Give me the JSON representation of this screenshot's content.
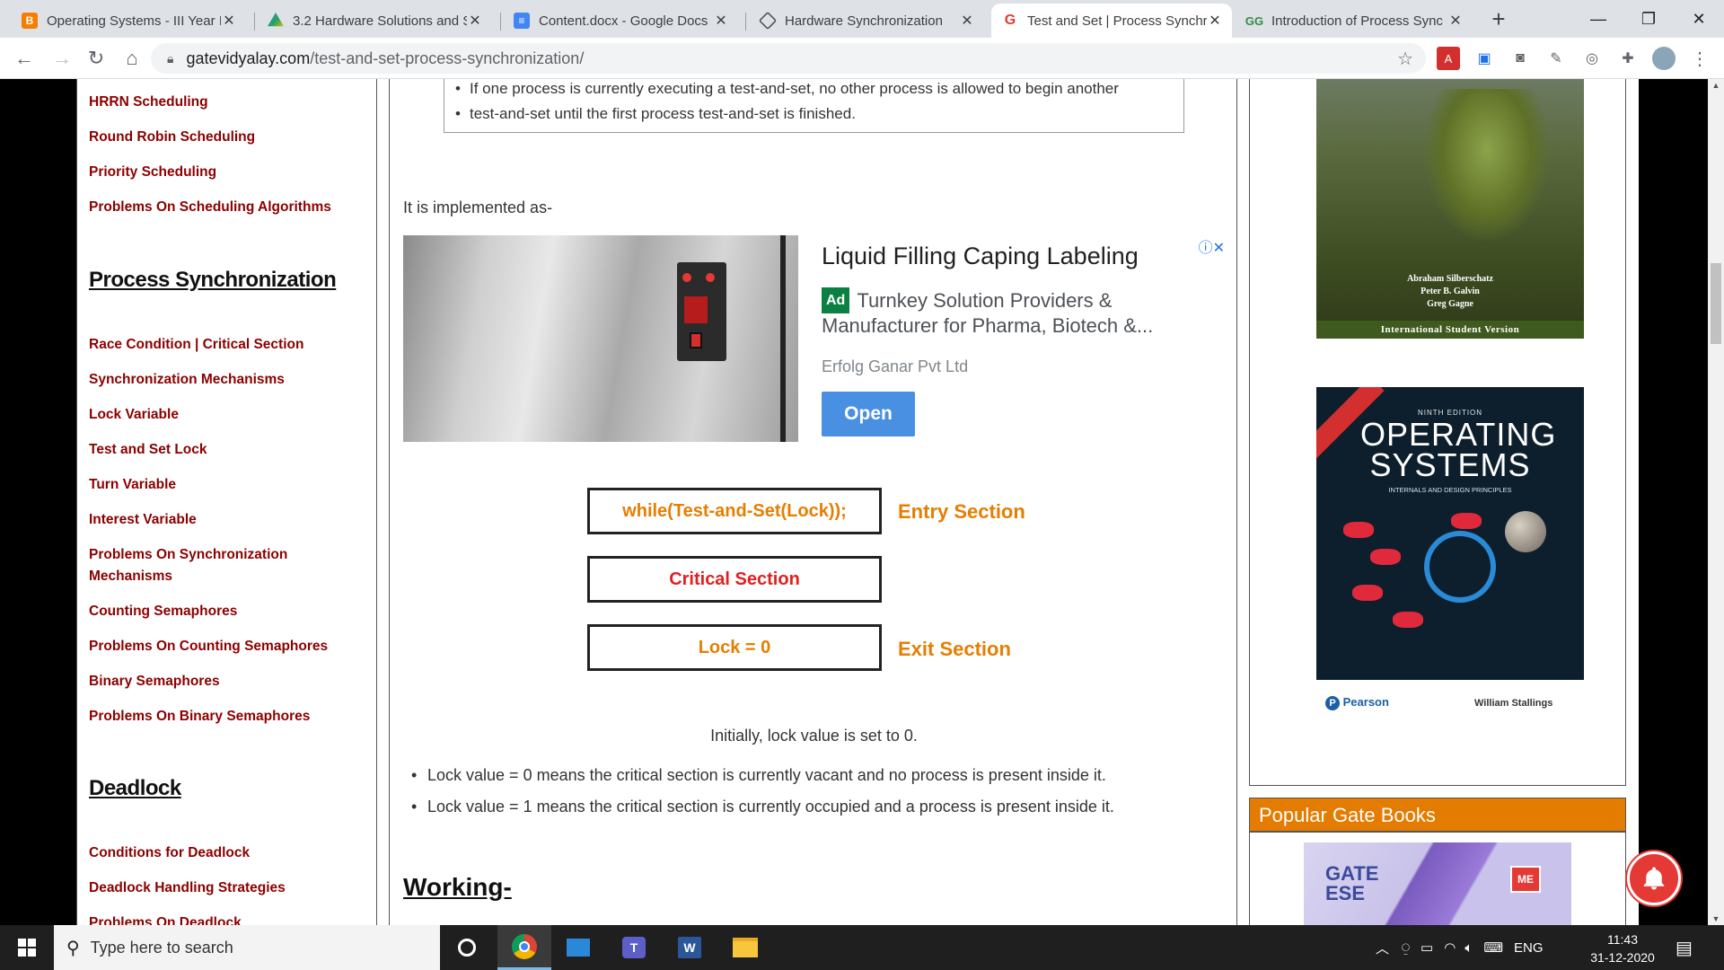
{
  "browser": {
    "tabs": [
      {
        "title": "Operating Systems - III Year I",
        "icon": "blogger-icon",
        "color": "#f57d00"
      },
      {
        "title": "3.2 Hardware Solutions and S",
        "icon": "google-drive-icon",
        "color": "#1fa463"
      },
      {
        "title": "Content.docx - Google Docs",
        "icon": "google-docs-icon",
        "color": "#4285f4"
      },
      {
        "title": "Hardware Synchronization",
        "icon": "diamond-site-icon",
        "color": "#555555"
      },
      {
        "title": "Test and Set | Process Synchr",
        "icon": "gate-vidyalay-icon",
        "color": "#e53935"
      },
      {
        "title": "Introduction of Process Sync",
        "icon": "geeksforgeeks-icon",
        "color": "#2f8d46"
      }
    ],
    "url_host": "gatevidyalay.com",
    "url_path": "/test-and-set-process-synchronization/"
  },
  "sidebar": {
    "links_top": [
      "HRRN Scheduling",
      "Round Robin Scheduling",
      "Priority Scheduling",
      "Problems On Scheduling Algorithms"
    ],
    "heading_sync": "Process Synchronization",
    "links_sync": [
      "Race Condition | Critical Section",
      "Synchronization Mechanisms",
      "Lock Variable",
      "Test and Set Lock",
      "Turn Variable",
      "Interest Variable",
      "Problems On Synchronization",
      "Mechanisms",
      "Counting Semaphores",
      "Problems On Counting Semaphores",
      "Binary Semaphores",
      "Problems On Binary Semaphores"
    ],
    "heading_deadlock": "Deadlock",
    "links_deadlock": [
      "Conditions for Deadlock",
      "Deadlock Handling Strategies",
      "Problems On Deadlock"
    ]
  },
  "main": {
    "note_line1": "If one process is currently executing a test-and-set, no other process is allowed to begin another",
    "note_line2": "test-and-set until the first process test-and-set is finished.",
    "implemented": "It is implemented as-",
    "ad": {
      "title": "Liquid Filling Caping Labeling",
      "badge": "Ad",
      "desc": "Turnkey Solution Providers & Manufacturer for Pharma, Biotech &...",
      "company": "Erfolg Ganar Pvt Ltd",
      "open": "Open",
      "info": "ⓘ✕"
    },
    "code": {
      "entry_code": "while(Test-and-Set(Lock));",
      "entry_label": "Entry Section",
      "critical": "Critical Section",
      "exit_code": "Lock = 0",
      "exit_label": "Exit Section"
    },
    "initially": "Initially, lock value is set to 0.",
    "bullet1": "Lock value = 0 means the critical section is currently vacant and no process is present inside it.",
    "bullet2": "Lock value = 1 means the critical section is currently occupied and a process is present inside it.",
    "working": "Working-"
  },
  "right": {
    "book1_authors": [
      "Abraham Silberschatz",
      "Peter B. Galvin",
      "Greg Gagne"
    ],
    "book1_edition": "International Student Version",
    "book2_edition": "NINTH EDITION",
    "book2_title": "OPERATING SYSTEMS",
    "book2_sub": "INTERNALS AND DESIGN PRINCIPLES",
    "book2_publisher": "Pearson",
    "book2_author": "William Stallings",
    "popular": "Popular Gate Books",
    "book3_title1": "GATE",
    "book3_title2": "ESE"
  },
  "taskbar": {
    "search_placeholder": "Type here to search",
    "lang": "ENG",
    "time": "11:43",
    "date": "31-12-2020"
  },
  "colors": {
    "sidebar_link": "#8b0000",
    "code_orange": "#e67e00",
    "critical_red": "#e02020",
    "accent": "#e37c00"
  }
}
